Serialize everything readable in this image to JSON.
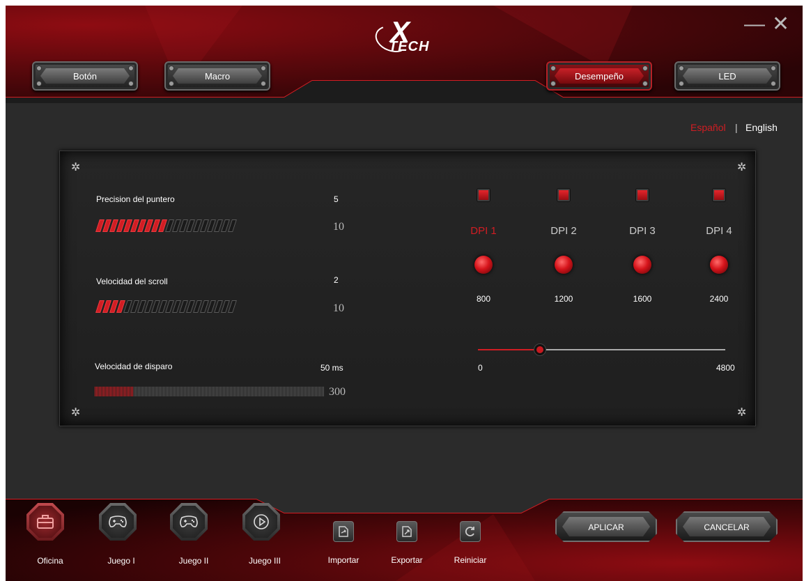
{
  "brand": {
    "logo_mark": "X",
    "logo_text": "TECH"
  },
  "window": {
    "minimize": "—",
    "close": "✕"
  },
  "tabs": [
    {
      "label": "Botón",
      "active": false
    },
    {
      "label": "Macro",
      "active": false
    },
    {
      "label": "Desempeño",
      "active": true
    },
    {
      "label": "LED",
      "active": false
    }
  ],
  "language": {
    "spanish": "Español",
    "separator": "|",
    "english": "English",
    "selected": "Español"
  },
  "pointer_precision": {
    "label": "Precision del puntero",
    "value": "5",
    "max": "10",
    "level": 5
  },
  "scroll_speed": {
    "label": "Velocidad del scroll",
    "value": "2",
    "max": "10",
    "level": 2
  },
  "fire_speed": {
    "label": "Velocidad de disparo",
    "value": "50 ms",
    "max": "300",
    "level_fraction": 0.1667
  },
  "dpi": {
    "levels": [
      {
        "label": "DPI 1",
        "value": "800",
        "active": true
      },
      {
        "label": "DPI 2",
        "value": "1200",
        "active": false
      },
      {
        "label": "DPI 3",
        "value": "1600",
        "active": false
      },
      {
        "label": "DPI 4",
        "value": "2400",
        "active": false
      }
    ],
    "slider_min": "0",
    "slider_max": "4800",
    "slider_value": 1200
  },
  "profiles": [
    {
      "label": "Oficina",
      "icon": "toolbox-icon",
      "active": true
    },
    {
      "label": "Juego I",
      "icon": "gamepad-icon",
      "active": false
    },
    {
      "label": "Juego II",
      "icon": "gamepad-icon",
      "active": false
    },
    {
      "label": "Juego III",
      "icon": "play-icon",
      "active": false
    }
  ],
  "tools": [
    {
      "label": "Importar",
      "icon": "import-icon"
    },
    {
      "label": "Exportar",
      "icon": "export-icon"
    },
    {
      "label": "Reiniciar",
      "icon": "reset-icon"
    }
  ],
  "actions": {
    "apply": "APLICAR",
    "cancel": "CANCELAR"
  },
  "colors": {
    "accent": "#d11d23",
    "background": "#2b2b2b"
  }
}
